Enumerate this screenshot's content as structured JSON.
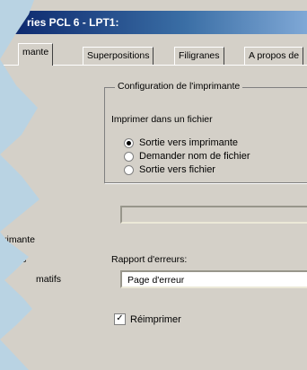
{
  "window": {
    "title": "ries PCL 6 - LPT1:"
  },
  "tabs": [
    {
      "label": "mante"
    },
    {
      "label": "Superpositions"
    },
    {
      "label": "Filigranes"
    },
    {
      "label": "A propos de"
    }
  ],
  "left": {
    "items": [
      "rimante",
      "s",
      "matifs"
    ]
  },
  "printer_config": {
    "group_title": "Configuration de l'imprimante",
    "print_to_file_label": "Imprimer dans un fichier",
    "radios": [
      {
        "label": "Sortie vers imprimante",
        "selected": true
      },
      {
        "label": "Demander nom de fichier",
        "selected": false
      },
      {
        "label": "Sortie vers fichier",
        "selected": false
      }
    ],
    "file_path_value": ""
  },
  "error_report": {
    "label": "Rapport d'erreurs:",
    "selected": "Page d'erreur"
  },
  "reprint": {
    "label": "Réimprimer",
    "checked": true,
    "check_glyph": "✓"
  },
  "colors": {
    "title_start": "#0a246a",
    "title_end": "#7fa8d6",
    "face": "#d4d0c8",
    "page_bg": "#b9d3e3"
  }
}
